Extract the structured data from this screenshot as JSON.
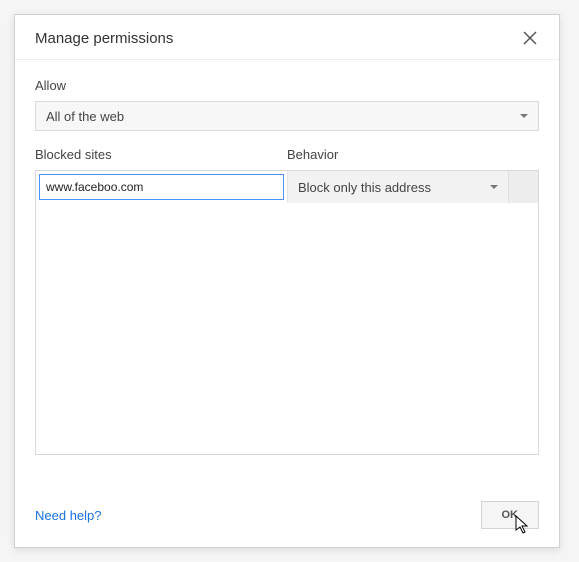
{
  "dialog": {
    "title": "Manage permissions"
  },
  "allow": {
    "label": "Allow",
    "selected": "All of the web"
  },
  "columns": {
    "blocked": "Blocked sites",
    "behavior": "Behavior"
  },
  "row": {
    "url": "www.faceboo.com",
    "behavior_selected": "Block only this address"
  },
  "footer": {
    "help": "Need help?",
    "ok": "OK"
  }
}
